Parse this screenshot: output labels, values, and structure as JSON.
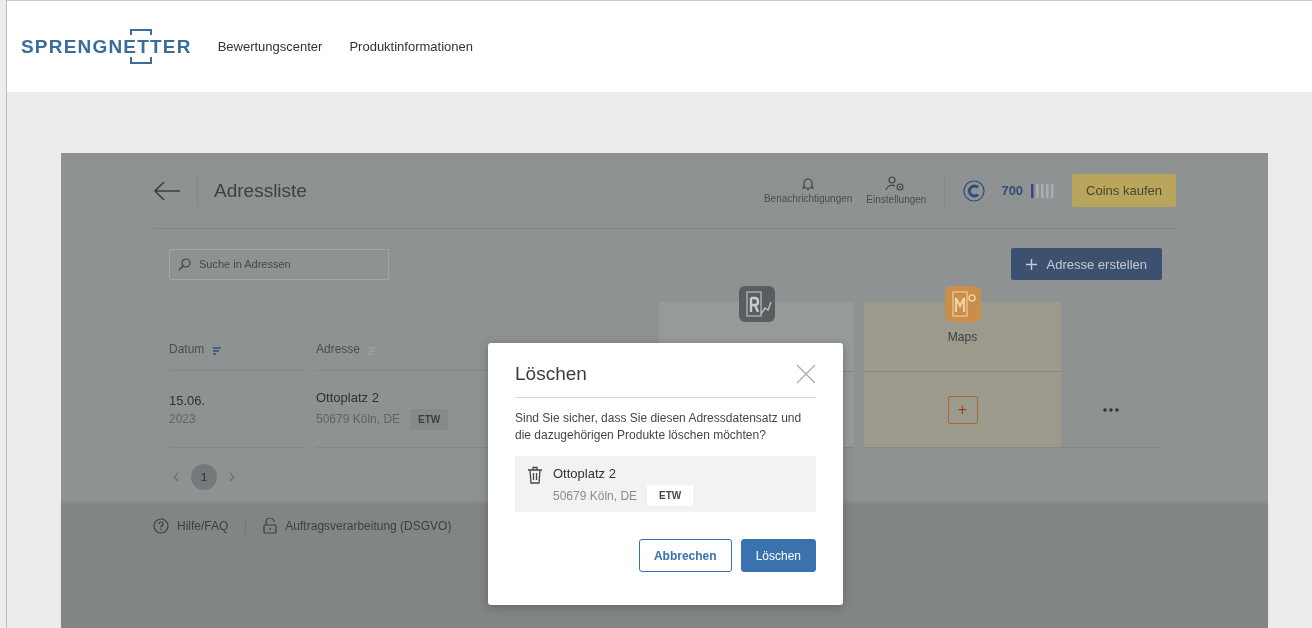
{
  "topbar": {
    "logo": "SPRENGNETTER",
    "nav": [
      "Bewertungscenter",
      "Produktinformationen"
    ]
  },
  "panel": {
    "title": "Adressliste",
    "notifications": "Benachrichtigungen",
    "settings": "Einstellungen",
    "coins": {
      "amount": "700",
      "level": 0.2
    },
    "buy_button": "Coins kaufen",
    "search": {
      "placeholder": "Suche in Adressen"
    },
    "create_button": "Adresse erstellen",
    "columns": [
      {
        "label": "Datum",
        "sort_active": true
      },
      {
        "label": "Adresse",
        "sort_active": false
      }
    ],
    "products": [
      {
        "kind": "report"
      },
      {
        "kind": "maps",
        "label": "Maps",
        "add_button": "+"
      }
    ],
    "rows": [
      {
        "date": "15.06.",
        "year": "2023",
        "street": "Ottoplatz 2",
        "city": "50679 Köln, DE",
        "tag": "ETW"
      }
    ],
    "pages": [
      {
        "label": "1",
        "selected": true
      }
    ],
    "footer": [
      "Hilfe/FAQ",
      "Auftragsverarbeitung (DSGVO)"
    ]
  },
  "dialog": {
    "title": "Löschen",
    "message": "Sind Sie sicher, dass Sie diesen Adressdatensatz und die dazugehörigen Produkte löschen möchten?",
    "item": {
      "street": "Ottoplatz 2",
      "city": "50679 Köln, DE",
      "tag": "ETW"
    },
    "buttons": [
      {
        "label": "Abbrechen",
        "kind": "secondary"
      },
      {
        "label": "Löschen",
        "kind": "primary"
      }
    ]
  }
}
